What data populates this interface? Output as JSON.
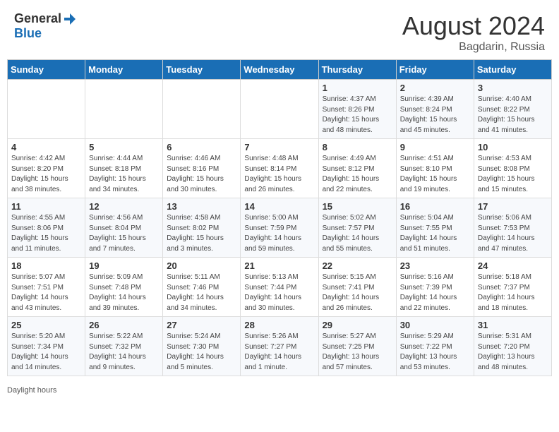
{
  "header": {
    "logo_general": "General",
    "logo_blue": "Blue",
    "month_year": "August 2024",
    "location": "Bagdarin, Russia"
  },
  "calendar": {
    "weekdays": [
      "Sunday",
      "Monday",
      "Tuesday",
      "Wednesday",
      "Thursday",
      "Friday",
      "Saturday"
    ],
    "weeks": [
      [
        {
          "day": "",
          "info": ""
        },
        {
          "day": "",
          "info": ""
        },
        {
          "day": "",
          "info": ""
        },
        {
          "day": "",
          "info": ""
        },
        {
          "day": "1",
          "info": "Sunrise: 4:37 AM\nSunset: 8:26 PM\nDaylight: 15 hours\nand 48 minutes."
        },
        {
          "day": "2",
          "info": "Sunrise: 4:39 AM\nSunset: 8:24 PM\nDaylight: 15 hours\nand 45 minutes."
        },
        {
          "day": "3",
          "info": "Sunrise: 4:40 AM\nSunset: 8:22 PM\nDaylight: 15 hours\nand 41 minutes."
        }
      ],
      [
        {
          "day": "4",
          "info": "Sunrise: 4:42 AM\nSunset: 8:20 PM\nDaylight: 15 hours\nand 38 minutes."
        },
        {
          "day": "5",
          "info": "Sunrise: 4:44 AM\nSunset: 8:18 PM\nDaylight: 15 hours\nand 34 minutes."
        },
        {
          "day": "6",
          "info": "Sunrise: 4:46 AM\nSunset: 8:16 PM\nDaylight: 15 hours\nand 30 minutes."
        },
        {
          "day": "7",
          "info": "Sunrise: 4:48 AM\nSunset: 8:14 PM\nDaylight: 15 hours\nand 26 minutes."
        },
        {
          "day": "8",
          "info": "Sunrise: 4:49 AM\nSunset: 8:12 PM\nDaylight: 15 hours\nand 22 minutes."
        },
        {
          "day": "9",
          "info": "Sunrise: 4:51 AM\nSunset: 8:10 PM\nDaylight: 15 hours\nand 19 minutes."
        },
        {
          "day": "10",
          "info": "Sunrise: 4:53 AM\nSunset: 8:08 PM\nDaylight: 15 hours\nand 15 minutes."
        }
      ],
      [
        {
          "day": "11",
          "info": "Sunrise: 4:55 AM\nSunset: 8:06 PM\nDaylight: 15 hours\nand 11 minutes."
        },
        {
          "day": "12",
          "info": "Sunrise: 4:56 AM\nSunset: 8:04 PM\nDaylight: 15 hours\nand 7 minutes."
        },
        {
          "day": "13",
          "info": "Sunrise: 4:58 AM\nSunset: 8:02 PM\nDaylight: 15 hours\nand 3 minutes."
        },
        {
          "day": "14",
          "info": "Sunrise: 5:00 AM\nSunset: 7:59 PM\nDaylight: 14 hours\nand 59 minutes."
        },
        {
          "day": "15",
          "info": "Sunrise: 5:02 AM\nSunset: 7:57 PM\nDaylight: 14 hours\nand 55 minutes."
        },
        {
          "day": "16",
          "info": "Sunrise: 5:04 AM\nSunset: 7:55 PM\nDaylight: 14 hours\nand 51 minutes."
        },
        {
          "day": "17",
          "info": "Sunrise: 5:06 AM\nSunset: 7:53 PM\nDaylight: 14 hours\nand 47 minutes."
        }
      ],
      [
        {
          "day": "18",
          "info": "Sunrise: 5:07 AM\nSunset: 7:51 PM\nDaylight: 14 hours\nand 43 minutes."
        },
        {
          "day": "19",
          "info": "Sunrise: 5:09 AM\nSunset: 7:48 PM\nDaylight: 14 hours\nand 39 minutes."
        },
        {
          "day": "20",
          "info": "Sunrise: 5:11 AM\nSunset: 7:46 PM\nDaylight: 14 hours\nand 34 minutes."
        },
        {
          "day": "21",
          "info": "Sunrise: 5:13 AM\nSunset: 7:44 PM\nDaylight: 14 hours\nand 30 minutes."
        },
        {
          "day": "22",
          "info": "Sunrise: 5:15 AM\nSunset: 7:41 PM\nDaylight: 14 hours\nand 26 minutes."
        },
        {
          "day": "23",
          "info": "Sunrise: 5:16 AM\nSunset: 7:39 PM\nDaylight: 14 hours\nand 22 minutes."
        },
        {
          "day": "24",
          "info": "Sunrise: 5:18 AM\nSunset: 7:37 PM\nDaylight: 14 hours\nand 18 minutes."
        }
      ],
      [
        {
          "day": "25",
          "info": "Sunrise: 5:20 AM\nSunset: 7:34 PM\nDaylight: 14 hours\nand 14 minutes."
        },
        {
          "day": "26",
          "info": "Sunrise: 5:22 AM\nSunset: 7:32 PM\nDaylight: 14 hours\nand 9 minutes."
        },
        {
          "day": "27",
          "info": "Sunrise: 5:24 AM\nSunset: 7:30 PM\nDaylight: 14 hours\nand 5 minutes."
        },
        {
          "day": "28",
          "info": "Sunrise: 5:26 AM\nSunset: 7:27 PM\nDaylight: 14 hours\nand 1 minute."
        },
        {
          "day": "29",
          "info": "Sunrise: 5:27 AM\nSunset: 7:25 PM\nDaylight: 13 hours\nand 57 minutes."
        },
        {
          "day": "30",
          "info": "Sunrise: 5:29 AM\nSunset: 7:22 PM\nDaylight: 13 hours\nand 53 minutes."
        },
        {
          "day": "31",
          "info": "Sunrise: 5:31 AM\nSunset: 7:20 PM\nDaylight: 13 hours\nand 48 minutes."
        }
      ]
    ]
  },
  "footer": {
    "daylight_label": "Daylight hours"
  }
}
